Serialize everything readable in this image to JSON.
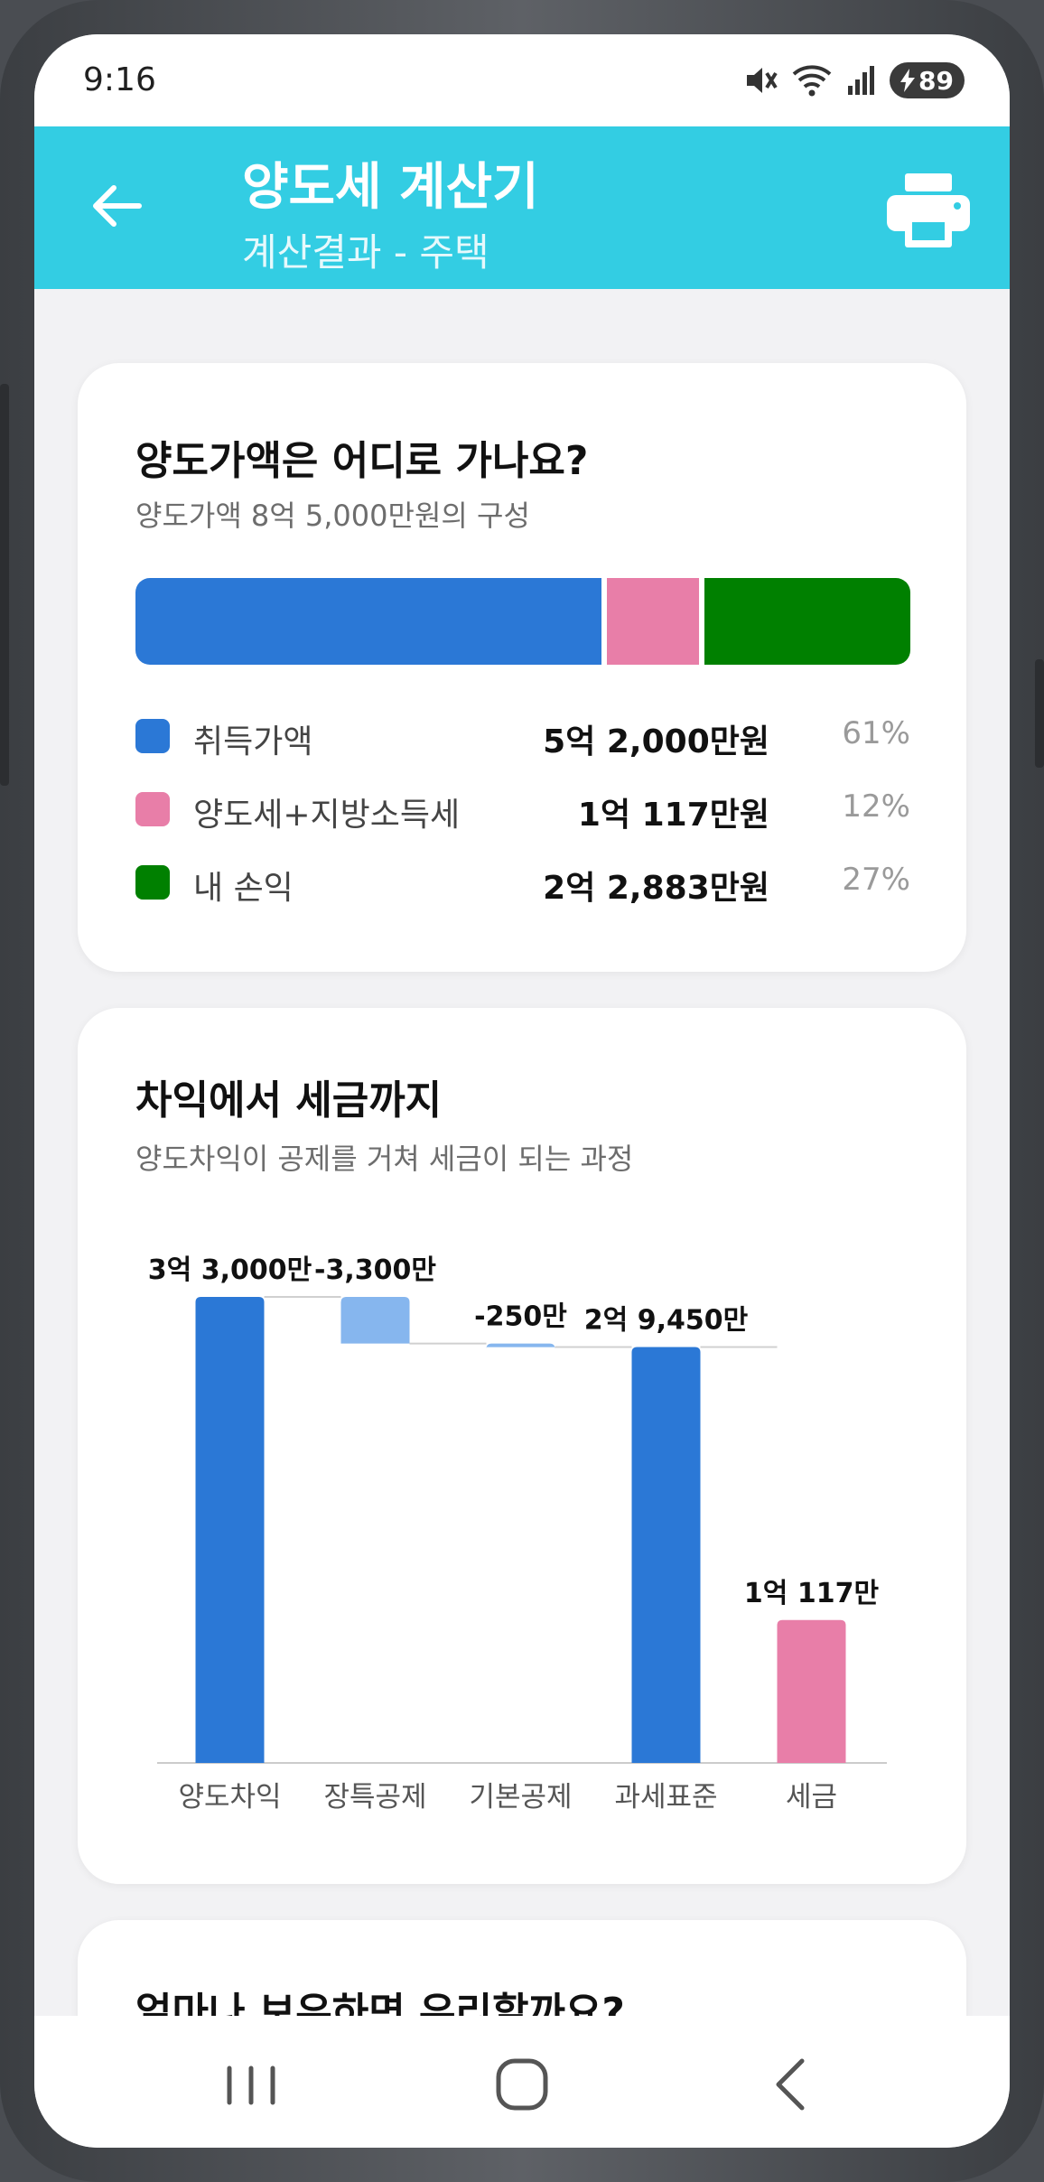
{
  "status": {
    "time": "9:16",
    "battery": "89"
  },
  "header": {
    "title": "양도세 계산기",
    "subtitle": "계산결과 - 주택"
  },
  "composition": {
    "title": "양도가액은 어디로 가나요?",
    "subtitle": "양도가액 8억 5,000만원의 구성",
    "items": [
      {
        "label": "취득가액",
        "amount": "5억 2,000만원",
        "pct": "61%",
        "share": 61,
        "color": "#2b78d6"
      },
      {
        "label": "양도세+지방소득세",
        "amount": "1억 117만원",
        "pct": "12%",
        "share": 12,
        "color": "#e87ea8"
      },
      {
        "label": "내 손익",
        "amount": "2억 2,883만원",
        "pct": "27%",
        "share": 27,
        "color": "#008000"
      }
    ]
  },
  "waterfall": {
    "title": "차익에서 세금까지",
    "subtitle": "양도차익이 공제를 거쳐 세금이 되는 과정"
  },
  "chart_data": {
    "type": "bar",
    "subtype": "waterfall",
    "categories": [
      "양도차익",
      "장특공제",
      "기본공제",
      "과세표준",
      "세금"
    ],
    "values": [
      33000,
      -3300,
      -250,
      29450,
      10117
    ],
    "value_labels": [
      "3억 3,000만",
      "-3,300만",
      "-250만",
      "2억 9,450만",
      "1억 117만"
    ],
    "kinds": [
      "total",
      "delta",
      "delta",
      "total",
      "total"
    ],
    "colors": [
      "#2b78d6",
      "#86b6ee",
      "#86b6ee",
      "#2b78d6",
      "#e87ea8"
    ],
    "ylim": [
      0,
      33000
    ],
    "grid": false
  },
  "next_card": {
    "title": "얼마나 보유하면 유리할까요?"
  }
}
